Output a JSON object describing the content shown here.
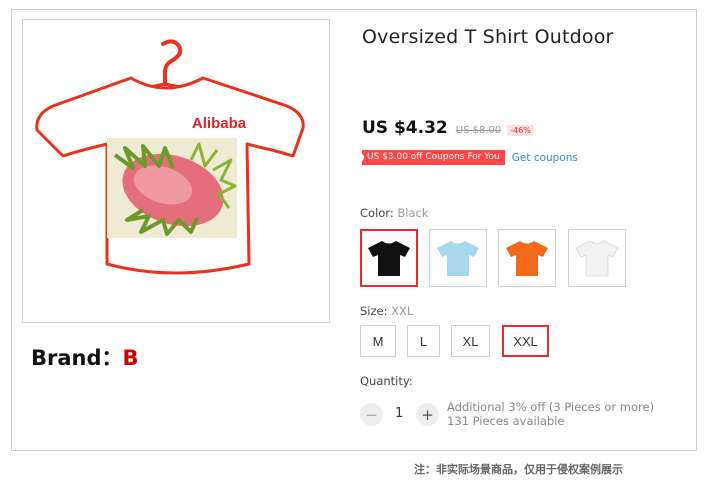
{
  "product": {
    "title": "Oversized T Shirt Outdoor",
    "price": "US $4.32",
    "original_price": "US $8.00",
    "discount": "-46%",
    "coupon_tag": "US $3.00 off Coupons For You",
    "get_coupons": "Get coupons",
    "image_logo_text": "Alibaba"
  },
  "brand": {
    "label": "Brand：",
    "value": "B"
  },
  "color": {
    "label": "Color:",
    "selected": "Black",
    "swatches": [
      {
        "name": "Black",
        "hex": "#111111"
      },
      {
        "name": "Light Blue",
        "hex": "#a9d8ee"
      },
      {
        "name": "Orange",
        "hex": "#f2691b"
      },
      {
        "name": "White",
        "hex": "#f2f2f2"
      }
    ]
  },
  "size": {
    "label": "Size:",
    "selected": "XXL",
    "options": [
      "M",
      "L",
      "XL",
      "XXL"
    ]
  },
  "quantity": {
    "label": "Quantity:",
    "minus": "−",
    "plus": "+",
    "value": "1",
    "promo": "Additional 3% off (3 Pieces or more)",
    "available": "131 Pieces available"
  },
  "footer_note": "注：非实际场景商品，仅用于侵权案例展示",
  "colors": {
    "accent": "#e62e2e",
    "link": "#2e8fd6",
    "coupon_bg": "#ff4747"
  }
}
